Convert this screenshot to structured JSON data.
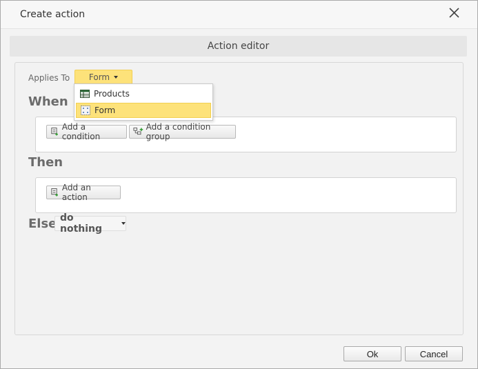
{
  "dialog": {
    "title": "Create action",
    "close_icon": "close-icon"
  },
  "editor": {
    "header": "Action editor",
    "applies_to": {
      "label": "Applies To",
      "selected": "Form",
      "options": [
        {
          "label": "Products",
          "icon": "table-icon"
        },
        {
          "label": "Form",
          "icon": "form-icon",
          "selected": true
        }
      ]
    },
    "when": {
      "label": "When",
      "add_condition": "Add a condition",
      "add_condition_group": "Add a condition group"
    },
    "then": {
      "label": "Then",
      "add_action": "Add an action"
    },
    "else": {
      "label": "Else",
      "value": "do nothing"
    }
  },
  "footer": {
    "ok": "Ok",
    "cancel": "Cancel"
  },
  "colors": {
    "accent": "#fde27a",
    "accent_border": "#f2cf52",
    "section_text": "#6b6b6b"
  }
}
